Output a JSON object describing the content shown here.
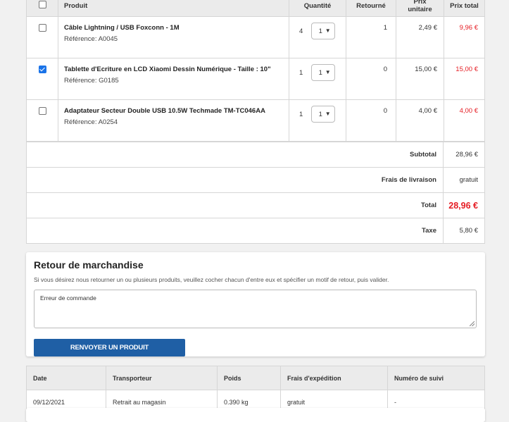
{
  "products_table": {
    "headers": {
      "product": "Produit",
      "quantity": "Quantité",
      "returned": "Retourné",
      "unit_price": "Prix unitaire",
      "total_price": "Prix total"
    },
    "rows": [
      {
        "checked": false,
        "name": "Câble Lightning / USB Foxconn - 1M",
        "reference": "Référence: A0045",
        "qty": "4",
        "qty_select": "1",
        "returned": "1",
        "unit_price": "2,49 €",
        "total_price": "9,96 €"
      },
      {
        "checked": true,
        "name": "Tablette d'Ecriture en LCD Xiaomi Dessin Numérique - Taille : 10\"",
        "reference": "Référence: G0185",
        "qty": "1",
        "qty_select": "1",
        "returned": "0",
        "unit_price": "15,00 €",
        "total_price": "15,00 €"
      },
      {
        "checked": false,
        "name": "Adaptateur Secteur Double USB 10.5W Techmade TM-TC046AA",
        "reference": "Référence: A0254",
        "qty": "1",
        "qty_select": "1",
        "returned": "0",
        "unit_price": "4,00 €",
        "total_price": "4,00 €"
      }
    ]
  },
  "totals": {
    "subtotal_label": "Subtotal",
    "subtotal_value": "28,96 €",
    "shipping_label": "Frais de livraison",
    "shipping_value": "gratuit",
    "total_label": "Total",
    "total_value": "28,96 €",
    "tax_label": "Taxe",
    "tax_value": "5,80 €"
  },
  "return_panel": {
    "title": "Retour de marchandise",
    "hint": "Si vous désirez nous retourner un ou plusieurs produits, veuillez cocher chacun d'entre eux et spécifier un motif de retour, puis valider.",
    "textarea_value": "Erreur de commande",
    "button_label": "RENVOYER UN PRODUIT"
  },
  "shipping_table": {
    "headers": [
      "Date",
      "Transporteur",
      "Poids",
      "Frais d'expédition",
      "Numéro de suivi"
    ],
    "row": [
      "09/12/2021",
      "Retrait au magasin",
      "0.390 kg",
      "gratuit",
      "-"
    ]
  },
  "colors": {
    "accent_button": "#1f5fa5",
    "price_red": "#e51c23",
    "checkbox_blue": "#1a73e8"
  }
}
